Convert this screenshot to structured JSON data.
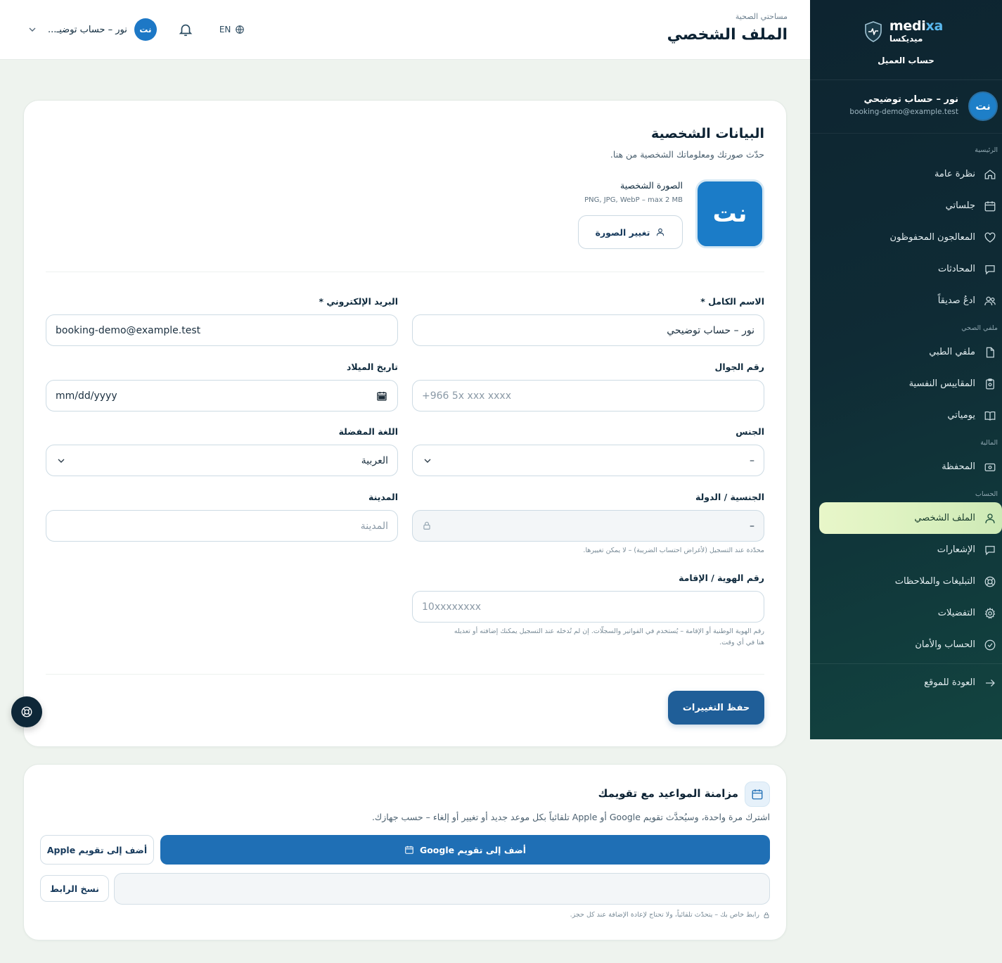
{
  "brand": {
    "name_prefix": "medi",
    "name_suffix": "xa",
    "name_ar": "ميديكسا",
    "subtitle": "حساب العميل"
  },
  "user": {
    "initials": "نت",
    "name": "نور – حساب توضيحي",
    "email": "booking-demo@example.test",
    "name_short": "نور – حساب توضيـ..."
  },
  "sidebar": {
    "sections": {
      "main": "الرئيسية",
      "health": "ملفي الصحي",
      "finance": "المالية",
      "account": "الحساب"
    },
    "items": {
      "overview": "نظرة عامة",
      "sessions": "جلساتي",
      "saved": "المعالجون المحفوظون",
      "chats": "المحادثات",
      "invite": "ادعُ صديقاً",
      "medical": "ملفي الطبي",
      "scales": "المقاييس النفسية",
      "journal": "يومياتي",
      "wallet": "المحفظة",
      "profile": "الملف الشخصي",
      "notifications": "الإشعارات",
      "reports": "التبليغات والملاحظات",
      "preferences": "التفضيلات",
      "security": "الحساب والأمان",
      "back": "العودة للموقع"
    },
    "active": "profile"
  },
  "header": {
    "breadcrumb": "مساحتي الصحية",
    "title": "الملف الشخصي",
    "lang": "EN"
  },
  "personal": {
    "title": "البيانات الشخصية",
    "subtitle": "حدّث صورتك ومعلوماتك الشخصية من هنا.",
    "photo_label": "الصورة الشخصية",
    "photo_hint": "PNG, JPG, WebP – max 2 MB",
    "photo_button": "تغيير الصورة",
    "fields": {
      "full_name": {
        "label": "الاسم الكامل *",
        "value": "نور – حساب توضيحي"
      },
      "email": {
        "label": "البريد الإلكتروني *",
        "value": "booking-demo@example.test"
      },
      "phone": {
        "label": "رقم الجوال",
        "placeholder": "+966 5x xxx xxxx"
      },
      "birth": {
        "label": "تاريخ الميلاد",
        "value": "mm/dd/yyyy"
      },
      "gender": {
        "label": "الجنس",
        "value": "–"
      },
      "language": {
        "label": "اللغة المفضلة",
        "value": "العربية"
      },
      "nationality": {
        "label": "الجنسية / الدولة",
        "value": "–",
        "note": "محدّدة عند التسجيل (لأغراض احتساب الضريبة) – لا يمكن تغييرها."
      },
      "city": {
        "label": "المدينة",
        "placeholder": "المدينة"
      },
      "national_id": {
        "label": "رقم الهوية / الإقامة",
        "placeholder": "10xxxxxxxx",
        "note_1": "رقم الهوية الوطنية أو الإقامة – يُستخدم في الفواتير والسجلّات. إن لم تُدخله عند التسجيل يمكنك إضافته أو تعديله",
        "note_2": "هنا في أي وقت."
      }
    },
    "save_button": "حفظ التغييرات"
  },
  "calendar": {
    "title": "مزامنة المواعيد مع تقويمك",
    "subtitle": "اشترك مرة واحدة، وسيُحدَّث تقويم Google أو Apple تلقائياً بكل موعد جديد أو تغيير أو إلغاء – حسب جهازك.",
    "google_button": "أضف إلى تقويم Google",
    "apple_button": "أضف إلى تقويم Apple",
    "copy_button": "نسخ الرابط",
    "note": "رابط خاص بك – يتحدّث تلقائياً، ولا تحتاج لإعادة الإضافة عند كل حجز."
  }
}
